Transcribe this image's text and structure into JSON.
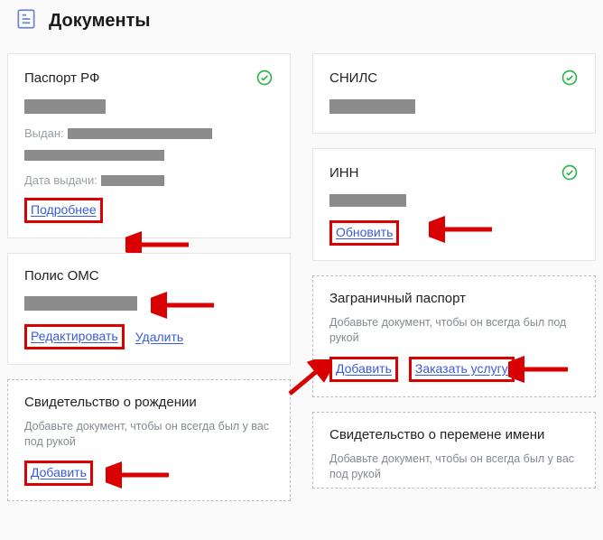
{
  "page": {
    "title": "Документы"
  },
  "cards": {
    "passport_rf": {
      "title": "Паспорт РФ",
      "issued_label": "Выдан:",
      "issue_date_label": "Дата выдачи:",
      "more_link": "Подробнее"
    },
    "polis_oms": {
      "title": "Полис ОМС",
      "edit_link": "Редактировать",
      "delete_link": "Удалить"
    },
    "birth_cert": {
      "title": "Свидетельство о рождении",
      "hint": "Добавьте документ, чтобы он всегда был у вас под рукой",
      "add_link": "Добавить"
    },
    "snils": {
      "title": "СНИЛС"
    },
    "inn": {
      "title": "ИНН",
      "refresh_link": "Обновить"
    },
    "foreign_passport": {
      "title": "Заграничный паспорт",
      "hint": "Добавьте документ, чтобы он всегда был под рукой",
      "add_link": "Добавить",
      "order_link": "Заказать услугу"
    },
    "name_change_cert": {
      "title": "Свидетельство о перемене имени",
      "hint": "Добавьте документ, чтобы он всегда был у вас под рукой"
    }
  }
}
